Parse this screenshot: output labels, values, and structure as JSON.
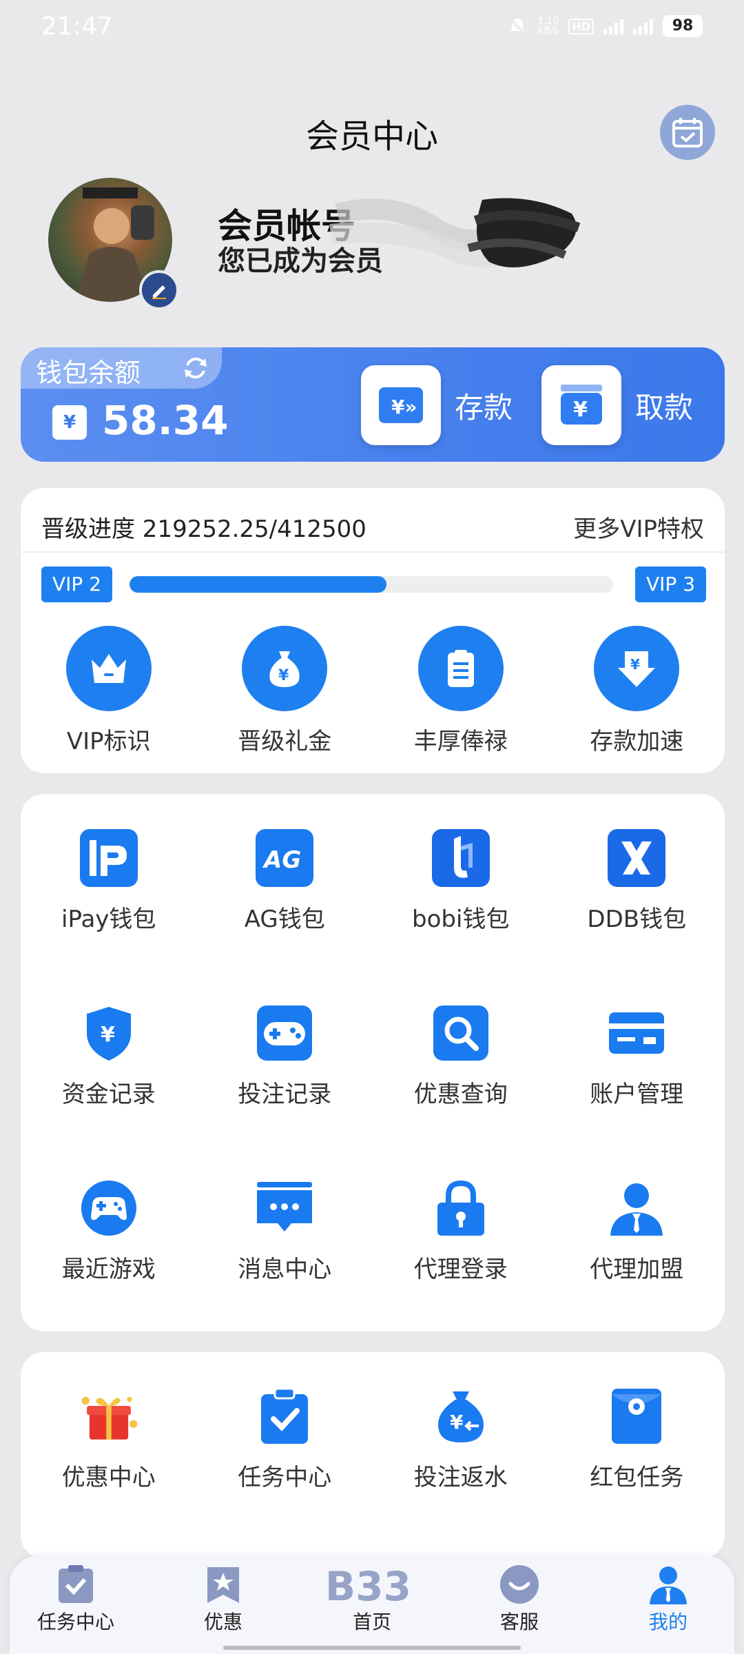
{
  "status_bar": {
    "time": "21:47",
    "net_speed_top": "1.10",
    "net_speed_unit": "KB/s",
    "battery": "98"
  },
  "header": {
    "title": "会员中心"
  },
  "profile": {
    "account_label": "会员帐号",
    "status_text": "您已成为会员"
  },
  "wallet": {
    "label": "钱包余额",
    "amount": "58.34",
    "deposit_label": "存款",
    "withdraw_label": "取款"
  },
  "vip": {
    "progress_text": "晋级进度 219252.25/412500",
    "more_link": "更多VIP特权",
    "current_level": "VIP 2",
    "next_level": "VIP 3",
    "progress_fraction": 0.5315,
    "perks": [
      {
        "label": "VIP标识",
        "icon": "crown-icon"
      },
      {
        "label": "晋级礼金",
        "icon": "money-bag-icon"
      },
      {
        "label": "丰厚俸禄",
        "icon": "clipboard-icon"
      },
      {
        "label": "存款加速",
        "icon": "deposit-arrow-icon"
      }
    ]
  },
  "tools": [
    {
      "label": "iPay钱包",
      "icon": "ipay-icon"
    },
    {
      "label": "AG钱包",
      "icon": "ag-icon"
    },
    {
      "label": "bobi钱包",
      "icon": "bobi-icon"
    },
    {
      "label": "DDB钱包",
      "icon": "ddb-icon"
    },
    {
      "label": "资金记录",
      "icon": "shield-yen-icon"
    },
    {
      "label": "投注记录",
      "icon": "gamepad-icon"
    },
    {
      "label": "优惠查询",
      "icon": "search-icon"
    },
    {
      "label": "账户管理",
      "icon": "card-icon"
    },
    {
      "label": "最近游戏",
      "icon": "controller-icon"
    },
    {
      "label": "消息中心",
      "icon": "message-icon"
    },
    {
      "label": "代理登录",
      "icon": "lock-icon"
    },
    {
      "label": "代理加盟",
      "icon": "agent-icon"
    }
  ],
  "promos": [
    {
      "label": "优惠中心",
      "icon": "gift-icon"
    },
    {
      "label": "任务中心",
      "icon": "task-clipboard-icon"
    },
    {
      "label": "投注返水",
      "icon": "rebate-bag-icon"
    },
    {
      "label": "红包任务",
      "icon": "red-envelope-icon"
    }
  ],
  "bottom_nav": [
    {
      "label": "任务中心",
      "icon": "task-icon"
    },
    {
      "label": "优惠",
      "icon": "promo-icon"
    },
    {
      "label": "首页",
      "icon": "b33-logo-icon"
    },
    {
      "label": "客服",
      "icon": "support-icon"
    },
    {
      "label": "我的",
      "icon": "profile-icon",
      "active": true
    }
  ],
  "colors": {
    "accent": "#1e80f0",
    "wallet_gradient_start": "#5b8ef0",
    "wallet_gradient_end": "#3b78ea"
  }
}
